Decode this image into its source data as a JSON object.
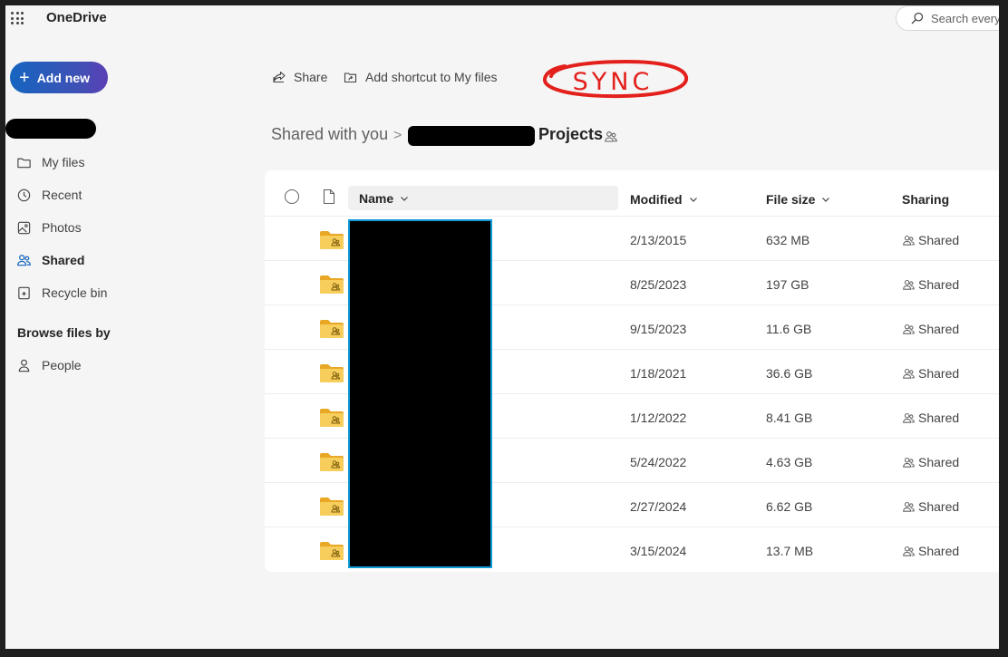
{
  "app": {
    "name": "OneDrive"
  },
  "search": {
    "placeholder": "Search every"
  },
  "sidebar": {
    "add_new_label": "Add new",
    "items": [
      {
        "label": "My files",
        "icon": "folder-icon",
        "active": false
      },
      {
        "label": "Recent",
        "icon": "clock-icon",
        "active": false
      },
      {
        "label": "Photos",
        "icon": "image-icon",
        "active": false
      },
      {
        "label": "Shared",
        "icon": "people-icon",
        "active": true
      },
      {
        "label": "Recycle bin",
        "icon": "recycle-bin-icon",
        "active": false
      }
    ],
    "browse_heading": "Browse files by",
    "browse_items": [
      {
        "label": "People",
        "icon": "person-icon"
      }
    ]
  },
  "commands": {
    "share": "Share",
    "add_shortcut": "Add shortcut to My files"
  },
  "annotation": {
    "text": "SYNC",
    "color": "#e3201b"
  },
  "breadcrumb": {
    "root": "Shared with you",
    "separator": ">",
    "current": "Projects"
  },
  "list": {
    "columns": {
      "name": "Name",
      "modified": "Modified",
      "size": "File size",
      "sharing": "Sharing"
    },
    "rows": [
      {
        "modified": "2/13/2015",
        "size": "632 MB",
        "sharing": "Shared"
      },
      {
        "modified": "8/25/2023",
        "size": "197 GB",
        "sharing": "Shared"
      },
      {
        "modified": "9/15/2023",
        "size": "11.6 GB",
        "sharing": "Shared"
      },
      {
        "modified": "1/18/2021",
        "size": "36.6 GB",
        "sharing": "Shared"
      },
      {
        "modified": "1/12/2022",
        "size": "8.41 GB",
        "sharing": "Shared"
      },
      {
        "modified": "5/24/2022",
        "size": "4.63 GB",
        "sharing": "Shared"
      },
      {
        "modified": "2/27/2024",
        "size": "6.62 GB",
        "sharing": "Shared"
      },
      {
        "modified": "3/15/2024",
        "size": "13.7 MB",
        "sharing": "Shared"
      }
    ]
  },
  "colors": {
    "accent": "#1565c0",
    "folder": "#f2c14e",
    "redaction_border": "#0f9bd7"
  }
}
